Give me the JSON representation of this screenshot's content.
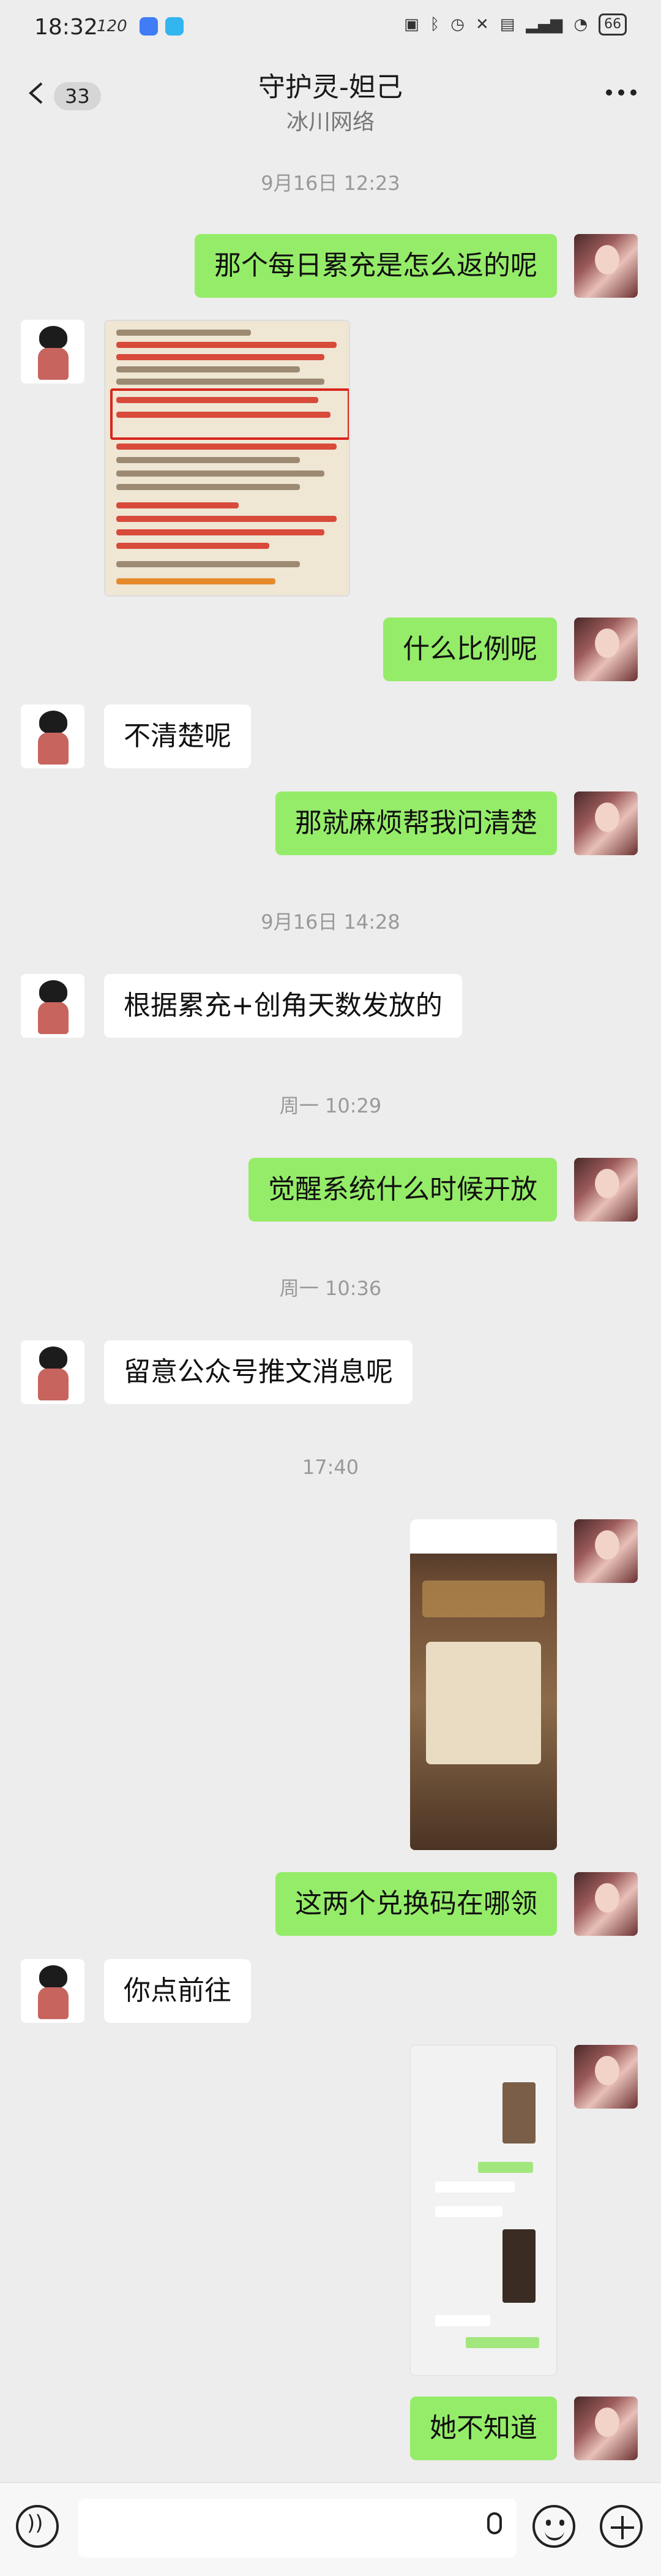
{
  "status_bar": {
    "time": "18:32",
    "refresh_rate": "120",
    "battery": "66"
  },
  "header": {
    "unread_count": "33",
    "title": "守护灵-妲己",
    "subtitle": "冰川网络"
  },
  "timestamps": [
    "9月16日 12:23",
    "9月16日 14:28",
    "周一 10:29",
    "周一 10:36",
    "17:40"
  ],
  "messages": {
    "m1": "那个每日累充是怎么返的呢",
    "m3": "什么比例呢",
    "m4": "不清楚呢",
    "m5": "那就麻烦帮我问清楚",
    "m6": "根据累充+创角天数发放的",
    "m7": "觉醒系统什么时候开放",
    "m8": "留意公众号推文消息呢",
    "m10": "这两个兑换码在哪领",
    "m11": "你点前往",
    "m13": "她不知道"
  },
  "icons": {
    "back": "chevron-left-icon",
    "more": "more-dots-icon",
    "voice": "voice-icon",
    "mic": "mic-icon",
    "emoji": "emoji-icon",
    "plus": "plus-icon"
  },
  "colors": {
    "background": "#ededed",
    "my_bubble": "#95ec69",
    "other_bubble": "#ffffff",
    "timestamp": "#999999"
  }
}
